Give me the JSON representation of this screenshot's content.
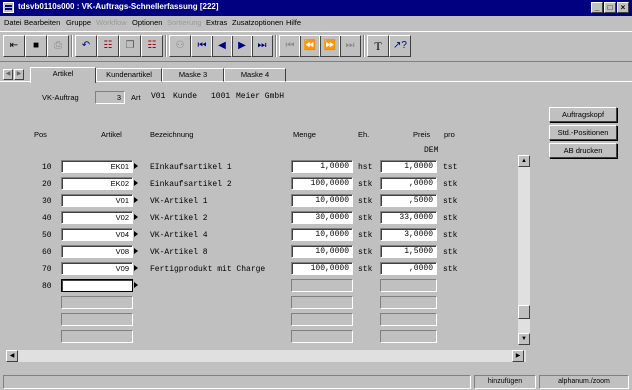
{
  "window": {
    "title": "tdsvb0110s000 : VK-Auftrags-Schnellerfassung [222]",
    "buttons": [
      "_",
      "□",
      "×"
    ]
  },
  "menu": [
    "Datei",
    "Bearbeiten",
    "Gruppe",
    "Workflow",
    "Optionen",
    "Sortierung",
    "Extras",
    "Zusatzoptionen",
    "Hilfe"
  ],
  "toolbar": {
    "icons": [
      "exit-icon",
      "save-icon",
      "print-icon",
      "undo-icon",
      "copy-record-icon",
      "duplicate-icon",
      "tree-icon",
      "find-icon",
      "first-record-icon",
      "previous-record-icon",
      "next-record-icon",
      "last-record-icon",
      "first-page-icon",
      "previous-page-icon",
      "next-page-icon",
      "last-page-icon",
      "text-icon",
      "help-icon"
    ]
  },
  "tabs": [
    "Artikel",
    "Kundenartikel",
    "Maske 3",
    "Maske 4"
  ],
  "header": {
    "vk_auftrag_label": "VK-Auftrag",
    "vk_auftrag_value": "3",
    "art_label": "Art",
    "art_value": "V01",
    "kunde_label": "Kunde",
    "kunde_value": "1001",
    "kunde_name": "Meier GmbH"
  },
  "columns": {
    "pos": "Pos",
    "artikel": "Artikel",
    "bezeichnung": "Bezeichnung",
    "menge": "Menge",
    "eh": "Eh.",
    "preis": "Preis",
    "pro": "pro",
    "currency": "DEM"
  },
  "rows": [
    {
      "pos": "10",
      "artikel": "EK01",
      "bezeichnung": "EInkaufsartikel 1",
      "menge": "1,0000",
      "eh": "hst",
      "preis": "1,0000",
      "pro": "tst"
    },
    {
      "pos": "20",
      "artikel": "EK02",
      "bezeichnung": "Einkaufsartikel 2",
      "menge": "100,0000",
      "eh": "stk",
      "preis": ",0000",
      "pro": "stk"
    },
    {
      "pos": "30",
      "artikel": "V01",
      "bezeichnung": "VK-Artikel 1",
      "menge": "10,0000",
      "eh": "stk",
      "preis": ",5000",
      "pro": "stk"
    },
    {
      "pos": "40",
      "artikel": "V02",
      "bezeichnung": "VK-Artikel 2",
      "menge": "30,0000",
      "eh": "stk",
      "preis": "33,0000",
      "pro": "stk"
    },
    {
      "pos": "50",
      "artikel": "V04",
      "bezeichnung": "VK-Artikel 4",
      "menge": "10,0000",
      "eh": "stk",
      "preis": "3,0000",
      "pro": "stk"
    },
    {
      "pos": "60",
      "artikel": "V08",
      "bezeichnung": "VK-Artikel 8",
      "menge": "10,0000",
      "eh": "stk",
      "preis": "1,5000",
      "pro": "stk"
    },
    {
      "pos": "70",
      "artikel": "V09",
      "bezeichnung": "Fertigprodukt mit Charge",
      "menge": "100,0000",
      "eh": "stk",
      "preis": ",0000",
      "pro": "stk"
    },
    {
      "pos": "80",
      "artikel": "",
      "bezeichnung": "",
      "menge": "",
      "eh": "",
      "preis": "",
      "pro": ""
    }
  ],
  "side_buttons": [
    "Auftragskopf",
    "Std.-Positionen",
    "AB drucken"
  ],
  "status": {
    "mode": "hinzufügen",
    "input": "alphanum./zoom"
  }
}
